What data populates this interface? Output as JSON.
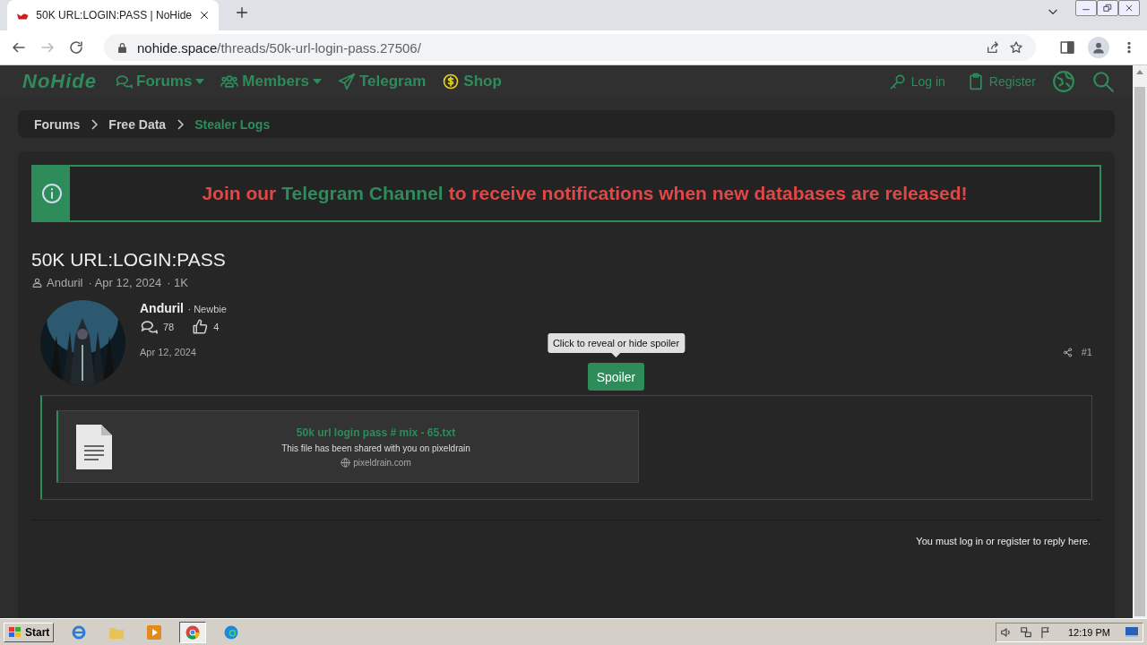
{
  "browser": {
    "tab": {
      "title": "50K URL:LOGIN:PASS | NoHide",
      "selected": true
    },
    "url": {
      "host": "nohide.space",
      "path": "/threads/50k-url-login-pass.27506/"
    }
  },
  "site_nav": {
    "logo": "NoHide",
    "items": [
      {
        "label": "Forums",
        "dropdown": true
      },
      {
        "label": "Members",
        "dropdown": true
      },
      {
        "label": "Telegram",
        "dropdown": false
      },
      {
        "label": "Shop",
        "dropdown": false
      }
    ],
    "account": [
      {
        "label": "Log in"
      },
      {
        "label": "Register"
      }
    ]
  },
  "breadcrumbs": [
    {
      "label": "Forums",
      "current": false
    },
    {
      "label": "Free Data",
      "current": false
    },
    {
      "label": "Stealer Logs",
      "current": true
    }
  ],
  "notice": {
    "segments": [
      {
        "text": "Join our",
        "kind": "text"
      },
      {
        "text": "Telegram Channel",
        "kind": "link"
      },
      {
        "text": "to receive notifications when new databases are released!",
        "kind": "text"
      }
    ]
  },
  "thread": {
    "title": "50K URL:LOGIN:PASS",
    "meta": [
      {
        "kind": "author",
        "text": "Anduril"
      },
      {
        "kind": "date",
        "text": "· Apr 12, 2024"
      },
      {
        "kind": "views",
        "text": "· 1K"
      }
    ]
  },
  "post": {
    "author": "Anduril",
    "rank": "· Newbie",
    "messages": "78",
    "reactions": "4",
    "date": "Apr 12, 2024",
    "number": "#1",
    "spoiler_button": "Spoiler",
    "tooltip": "Click to reveal or hide spoiler",
    "attachment": {
      "name": "50k url login pass # mix - 65.txt",
      "description": "This file has been shared with you on pixeldrain",
      "source": "pixeldrain.com"
    }
  },
  "reply_note": "You must log in or register to reply here.",
  "taskbar": {
    "start": "Start",
    "clock": "12:19 PM"
  }
}
